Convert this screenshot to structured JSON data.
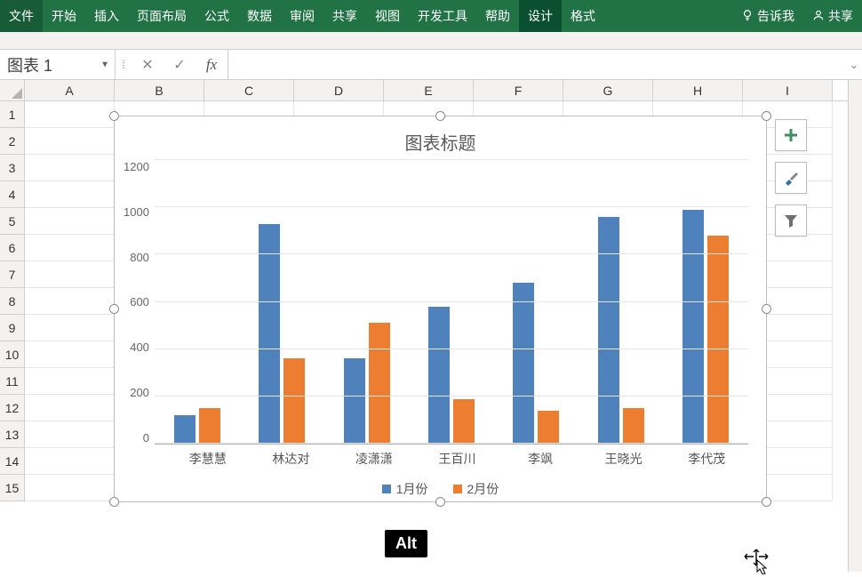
{
  "ribbon": {
    "file": "文件",
    "tabs": [
      "开始",
      "插入",
      "页面布局",
      "公式",
      "数据",
      "审阅",
      "共享",
      "视图",
      "开发工具",
      "帮助"
    ],
    "context_tabs": [
      "设计",
      "格式"
    ],
    "tell_me": "告诉我",
    "share": "共享"
  },
  "formula_bar": {
    "name_box": "图表 1",
    "fx_label": "fx",
    "formula_value": ""
  },
  "grid": {
    "columns": [
      "A",
      "B",
      "C",
      "D",
      "E",
      "F",
      "G",
      "H",
      "I"
    ],
    "rows": [
      "1",
      "2",
      "3",
      "4",
      "5",
      "6",
      "7",
      "8",
      "9",
      "10",
      "11",
      "12",
      "13",
      "14",
      "15"
    ]
  },
  "chart_data": {
    "type": "bar",
    "title": "图表标题",
    "categories": [
      "李慧慧",
      "林达对",
      "凌潇潇",
      "王百川",
      "李飒",
      "王晓光",
      "李代茂"
    ],
    "series": [
      {
        "name": "1月份",
        "values": [
          120,
          930,
          360,
          580,
          680,
          960,
          990
        ]
      },
      {
        "name": "2月份",
        "values": [
          150,
          360,
          510,
          190,
          140,
          150,
          880
        ]
      }
    ],
    "ylim": [
      0,
      1200
    ],
    "ystep": 200,
    "xlabel": "",
    "ylabel": "",
    "colors": {
      "series1": "#4f81bd",
      "series2": "#ed7d31"
    }
  },
  "side_tools": {
    "add": "chart-add-element",
    "style": "chart-styles",
    "filter": "chart-filter"
  },
  "overlay": {
    "alt_key": "Alt"
  }
}
